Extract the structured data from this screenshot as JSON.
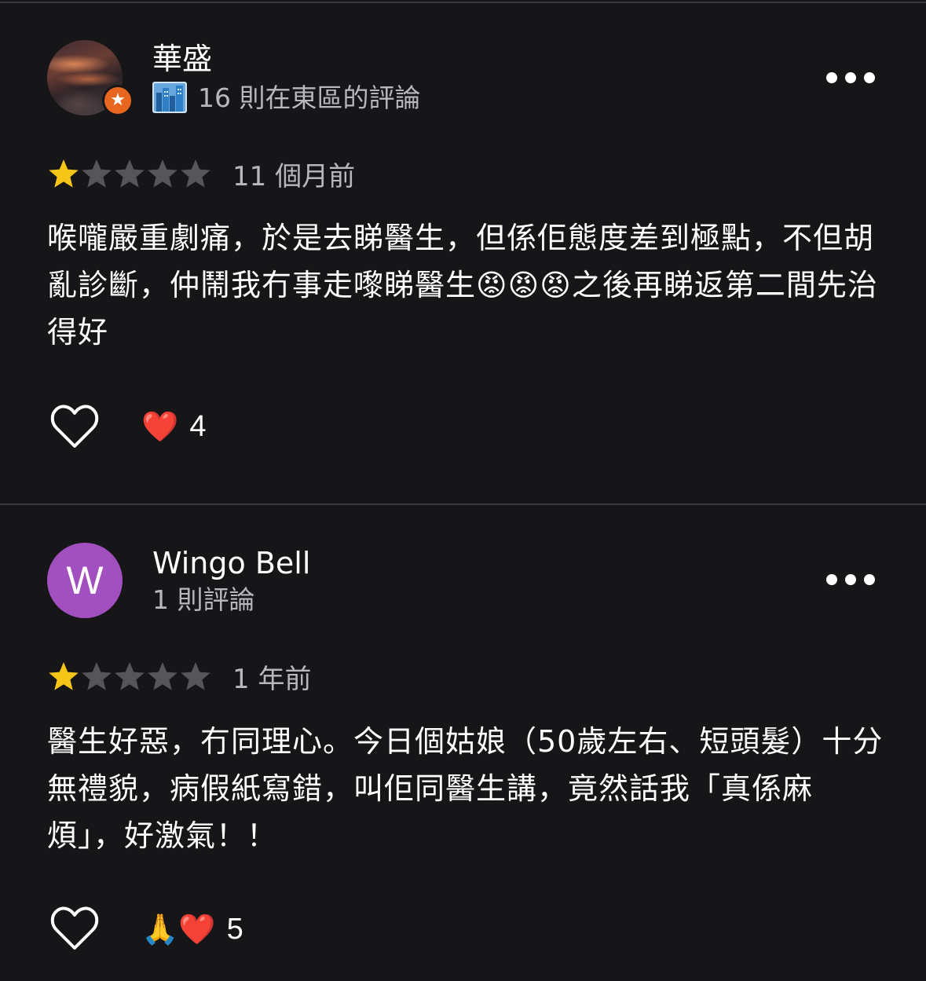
{
  "reviews": [
    {
      "author": "華盛",
      "author_meta": "16 則在東區的評論",
      "local_guide": true,
      "avatar_type": "photo",
      "meta_icon": "city-skyline-icon",
      "rating": 1,
      "max_rating": 5,
      "date": "11 個月前",
      "text": "喉嚨嚴重劇痛，於是去睇醫生，但係佢態度差到極點，不但胡亂診斷，仲鬧我冇事走嚟睇醫生😡😡😡之後再睇返第二間先治得好",
      "reaction_emojis": "❤️",
      "reaction_count": "4"
    },
    {
      "author": "Wingo Bell",
      "avatar_letter": "W",
      "avatar_color": "#a24fc0",
      "author_meta": "1 則評論",
      "rating": 1,
      "max_rating": 5,
      "date": "1 年前",
      "text": "醫生好惡，冇同理心。今日個姑娘（50歲左右、短頭髮）十分無禮貌，病假紙寫錯，叫佢同醫生講，竟然話我「真係麻煩」，好激氣！！",
      "reaction_emojis": "🙏❤️",
      "reaction_count": "5"
    }
  ],
  "colors": {
    "background": "#161618",
    "divider": "#3a3a3e",
    "star_filled": "#f5c518",
    "star_empty": "#55555a",
    "secondary_text": "#b8b8bc",
    "local_guide_badge": "#e8671e"
  }
}
